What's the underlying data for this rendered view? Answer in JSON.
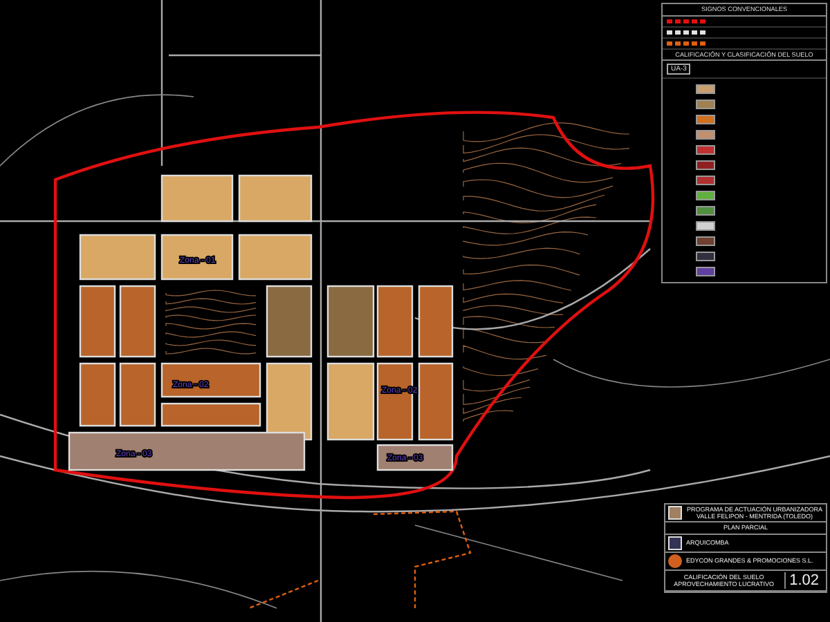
{
  "legend": {
    "title": "SIGNOS CONVENCIONALES",
    "lines": [
      {
        "color": "#e01010"
      },
      {
        "color": "#e0e0e0"
      },
      {
        "color": "#e06010"
      }
    ],
    "section_title": "CALIFICACIÓN Y CLASIFICACIÓN DEL SUELO",
    "unit_tag": "UA-3",
    "swatches": [
      {
        "color": "#c8a070"
      },
      {
        "color": "#a08050"
      },
      {
        "color": "#d07020"
      },
      {
        "color": "#c09070"
      },
      {
        "color": "#c03030"
      },
      {
        "color": "#902020"
      },
      {
        "color": "#b03030"
      },
      {
        "color": "#60b040"
      },
      {
        "color": "#509040"
      },
      {
        "color": "#d0d0d0"
      },
      {
        "color": "#704030"
      },
      {
        "color": "#303040"
      },
      {
        "color": "#6040a0"
      }
    ]
  },
  "map": {
    "blocks": [
      {
        "color": "#d9a865"
      },
      {
        "color": "#d9a865"
      },
      {
        "color": "#d9a865"
      },
      {
        "color": "#d9a865"
      },
      {
        "color": "#d9a865"
      },
      {
        "color": "#b8642a"
      },
      {
        "color": "#b8642a"
      },
      {
        "color": "#8a6a40"
      },
      {
        "color": "#8a6a40"
      },
      {
        "color": "#b8642a"
      },
      {
        "color": "#b8642a"
      },
      {
        "color": "#b8642a"
      },
      {
        "color": "#b8642a"
      },
      {
        "color": "#b8642a"
      },
      {
        "color": "#b8642a"
      },
      {
        "color": "#d9a865"
      },
      {
        "color": "#d9a865"
      },
      {
        "color": "#b8642a"
      },
      {
        "color": "#b8642a"
      },
      {
        "color": "#a08070"
      },
      {
        "color": "#a08070"
      }
    ],
    "zones": [
      "Zona - 01",
      "Zona - 02",
      "Zona - 02",
      "Zona - 03",
      "Zona - 03"
    ]
  },
  "title_block": {
    "project": "PROGRAMA DE ACTUACIÓN URBANIZADORA",
    "place": "VALLE FELIPON - MENTRIDA (TOLEDO)",
    "phase": "PLAN PARCIAL",
    "architect": "ARQUICOMBA",
    "promoter": "EDYCON GRANDES & PROMOCIONES S.L.",
    "plan_title": "CALIFICACIÓN DEL SUELO",
    "plan_subtitle": "APROVECHAMIENTO LUCRATIVO",
    "plan_number": "1.02"
  }
}
